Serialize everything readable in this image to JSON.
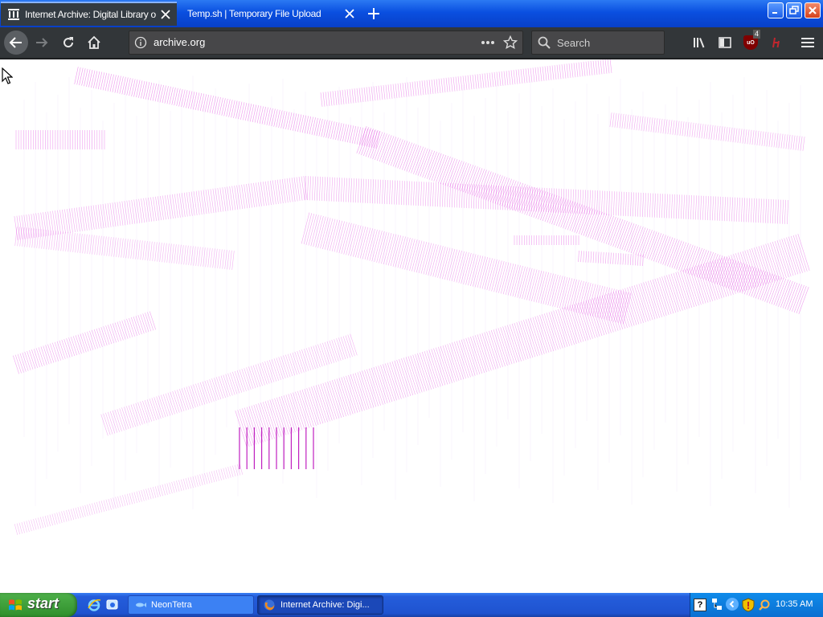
{
  "browser": {
    "tabs": [
      {
        "label": "Internet Archive: Digital Library of"
      },
      {
        "label": "Temp.sh | Temporary File Upload"
      }
    ],
    "url": "archive.org",
    "search_placeholder": "Search",
    "ublock_count": "4",
    "ublock_label": "uO"
  },
  "taskbar": {
    "start_label": "start",
    "items": [
      {
        "label": "NeonTetra"
      },
      {
        "label": "Internet Archive: Digi..."
      }
    ],
    "clock": "10:35 AM"
  },
  "colors": {
    "glitch": "#e040e0",
    "xp_blue": "#245ddb",
    "start_green": "#3c9a38",
    "toolbar": "#323639"
  }
}
